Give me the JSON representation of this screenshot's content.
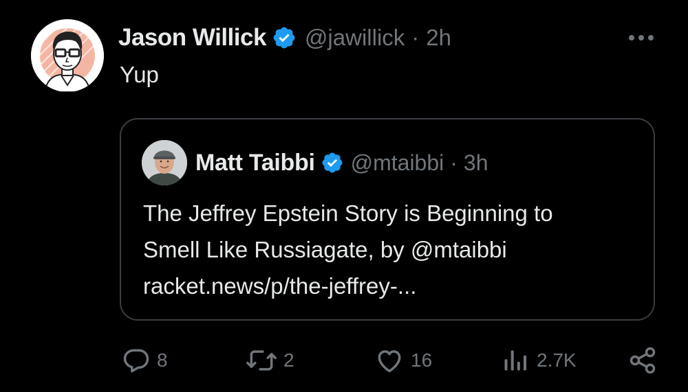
{
  "tweet": {
    "display_name": "Jason Willick",
    "handle": "@jawillick",
    "separator": "·",
    "time": "2h",
    "text": "Yup",
    "avatar_icon": "caricature-avatar",
    "verified_icon": "verified-badge-icon",
    "more_icon": "more-options-icon"
  },
  "quote": {
    "display_name": "Matt Taibbi",
    "handle": "@mtaibbi",
    "separator": "·",
    "time": "3h",
    "body_lines": [
      "The Jeffrey Epstein Story is Beginning to",
      "Smell Like Russiagate, by @mtaibbi",
      "racket.news/p/the-jeffrey-..."
    ]
  },
  "actions": {
    "replies": "8",
    "reposts": "2",
    "likes": "16",
    "views": "2.7K"
  },
  "colors": {
    "background": "#000000",
    "text_primary": "#e7e9ea",
    "text_secondary": "#71767b",
    "verified_blue": "#1d9bf0",
    "quote_border": "#3b3e42"
  }
}
